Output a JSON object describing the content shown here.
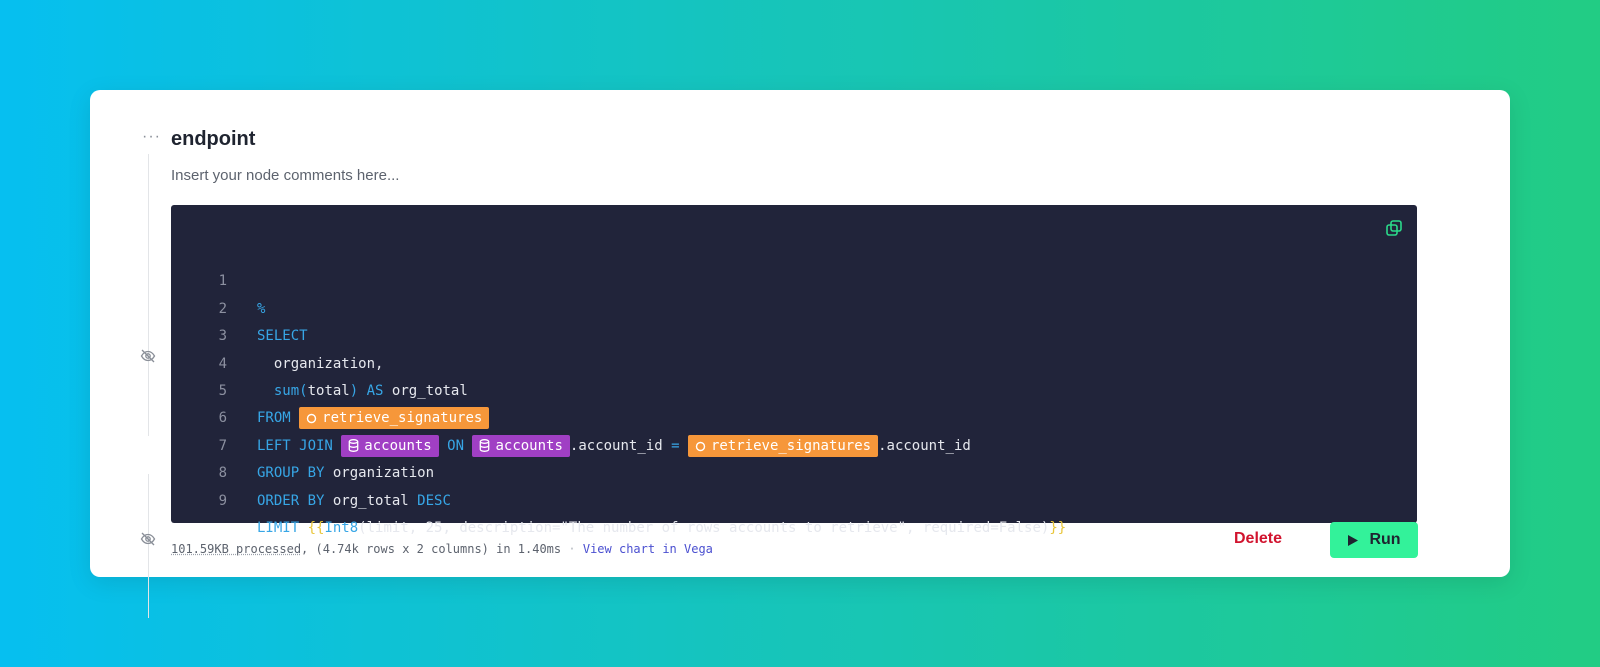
{
  "node": {
    "title": "endpoint",
    "comment_placeholder": "Insert your node comments here..."
  },
  "code": {
    "lines": [
      {
        "number": "1"
      },
      {
        "number": "2",
        "keyword": "SELECT"
      },
      {
        "number": "3",
        "text": "organization,"
      },
      {
        "number": "4",
        "func": "sum",
        "open": "(",
        "arg": "total",
        "close": ")",
        "keyword": "AS",
        "alias": "org_total"
      },
      {
        "number": "5",
        "keyword": "FROM",
        "pipe": "retrieve_signatures"
      },
      {
        "number": "6",
        "keyword": "LEFT JOIN",
        "ds1": "accounts",
        "on": "ON",
        "ds2": "accounts",
        "col1": ".account_id",
        "eq": "=",
        "pipe": "retrieve_signatures",
        "col2": ".account_id"
      },
      {
        "number": "7",
        "keyword": "GROUP BY",
        "text": "organization"
      },
      {
        "number": "8",
        "keyword": "ORDER BY",
        "text": "org_total",
        "keyword2": "DESC"
      },
      {
        "number": "9",
        "keyword": "LIMIT",
        "open_brace": "{{",
        "func": "Int8",
        "args": "(limit, 25, description=\"The number of rows accounts to retrieve\", required=False)",
        "close_brace": "}}"
      }
    ],
    "percent": "%"
  },
  "footer": {
    "processed": "101.59KB processed",
    "stats": ", (4.74k rows x 2 columns) in 1.40ms",
    "separator": "·",
    "vega_link": "View chart in Vega"
  },
  "actions": {
    "delete_label": "Delete",
    "run_label": "Run"
  },
  "colors": {
    "keyword": "#37a6e6",
    "pipe_pill": "#f6973a",
    "datasource_pill": "#a03fc4",
    "run_button": "#33f29a",
    "delete_text": "#d1132e",
    "copy_icon": "#2bd98a"
  },
  "icons": [
    "more-dots-icon",
    "eye-off-icon",
    "copy-icon",
    "pipe-circle-icon",
    "database-icon",
    "play-icon"
  ]
}
